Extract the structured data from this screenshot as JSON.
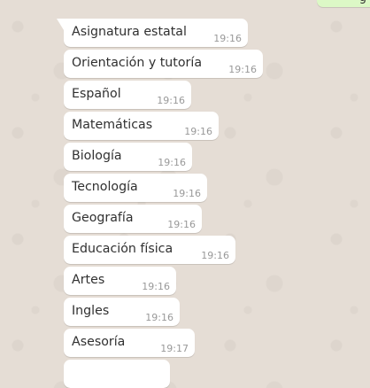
{
  "colors": {
    "chat_background": "#e5ddd5",
    "incoming_bubble": "#ffffff",
    "outgoing_bubble": "#dcf8c6",
    "message_text": "#303030",
    "timestamp_text": "#999999"
  },
  "outgoing_fragment": {
    "glyph": "g"
  },
  "messages": [
    {
      "text": "Asignatura estatal",
      "time": "19:16"
    },
    {
      "text": "Orientación y tutoría",
      "time": "19:16"
    },
    {
      "text": "Español",
      "time": "19:16"
    },
    {
      "text": "Matemáticas",
      "time": "19:16"
    },
    {
      "text": "Biología",
      "time": "19:16"
    },
    {
      "text": "Tecnología",
      "time": "19:16"
    },
    {
      "text": "Geografía",
      "time": "19:16"
    },
    {
      "text": "Educación física",
      "time": "19:16"
    },
    {
      "text": "Artes",
      "time": "19:16"
    },
    {
      "text": "Ingles",
      "time": "19:16"
    },
    {
      "text": "Asesoría",
      "time": "19:17"
    },
    {
      "text": "",
      "time": ""
    }
  ]
}
